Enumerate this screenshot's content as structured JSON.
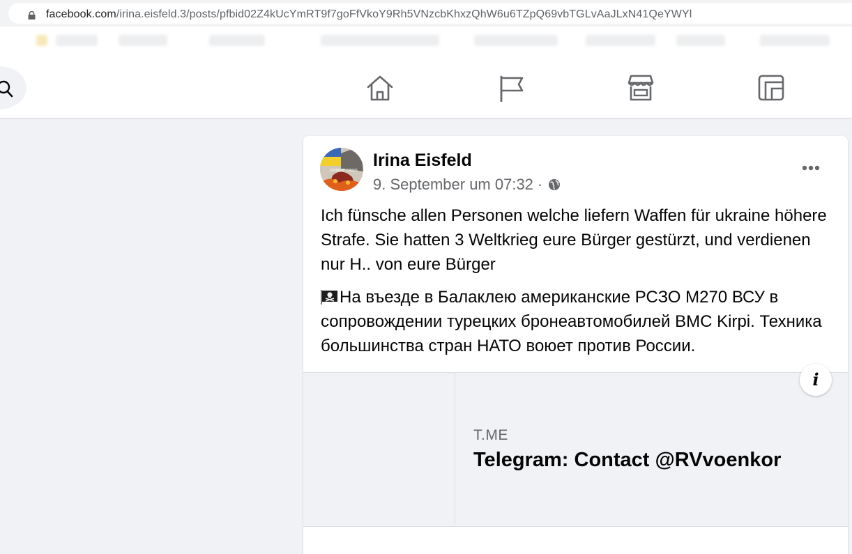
{
  "browser": {
    "url_host": "facebook.com",
    "url_path": "/irina.eisfeld.3/posts/pfbid02Z4kUcYmRT9f7goFfVkoY9Rh5VNzcbKhxzQhW6u6TZpQ69vbTGLvAaJLxN41QeYWYl"
  },
  "nav": {
    "icons": [
      "search-icon",
      "home-icon",
      "pages-flag-icon",
      "marketplace-icon",
      "gaming-icon"
    ]
  },
  "post": {
    "author": "Irina Eisfeld",
    "timestamp": "9. September um 07:32",
    "separator": "·",
    "privacy_icon": "globe-icon",
    "paragraph_1": "Ich fünsche allen Personen  welche liefern  Waffen  für ukraine höhere Strafe.  Sie hatten 3 Weltkrieg eure Bürger gestürzt, und verdienen  nur H.. von eure Bürger",
    "paragraph_2": "На въезде в Балаклею американские РСЗО М270 ВСУ в сопровождении турецких бронеавтомобилей BMC Kirpi. Техника большинства стран НАТО воюет против России.",
    "paragraph_2_emoji": "pirate-flag-icon",
    "avatar_caption": "UKRAINE CRISIS"
  },
  "link_preview": {
    "domain": "T.ME",
    "title": "Telegram: Contact @RVvoenkor",
    "info_label": "i"
  },
  "colors": {
    "page_bg": "#f0f2f5",
    "text_primary": "#050505",
    "text_secondary": "#65676b",
    "icon_gray": "#65676b"
  }
}
